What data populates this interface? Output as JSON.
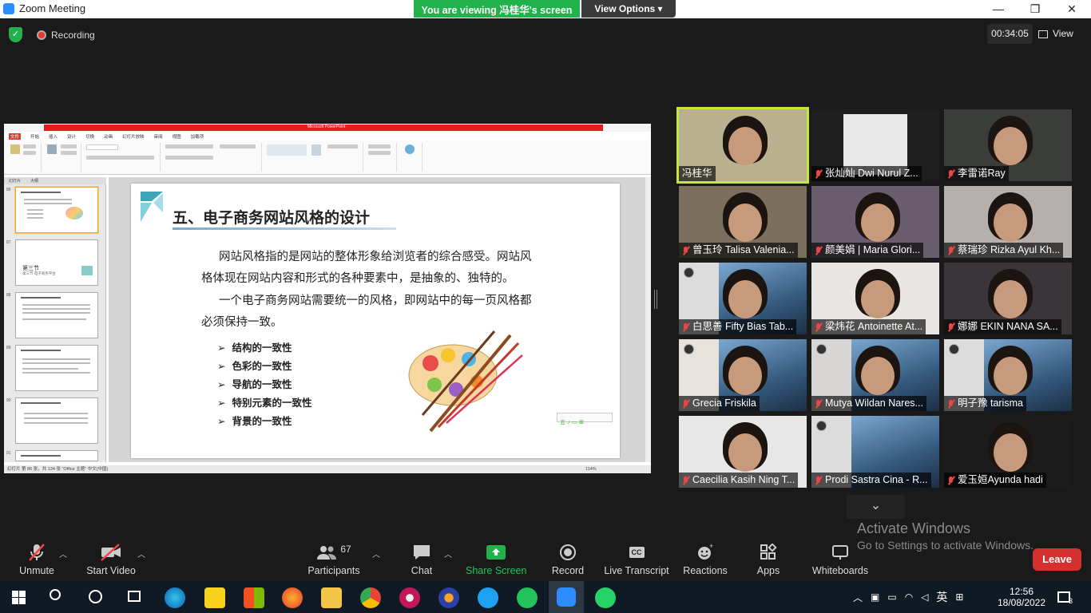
{
  "window": {
    "title": "Zoom Meeting",
    "minimize": "—",
    "restore": "❐",
    "close": "✕"
  },
  "banner": {
    "viewing": "You are viewing 冯桂华's screen",
    "view_options": "View Options ▾"
  },
  "status": {
    "recording": "Recording",
    "timer": "00:34:05",
    "view": "View"
  },
  "ppt": {
    "title": "Microsoft PowerPoint",
    "tabs": [
      "文件",
      "开始",
      "插入",
      "设计",
      "切换",
      "动画",
      "幻灯片放映",
      "审阅",
      "视图",
      "加载项"
    ],
    "left_tabs": [
      "幻灯片",
      "大纲"
    ],
    "slide_nums": [
      "86",
      "87",
      "88",
      "89",
      "90",
      "91"
    ],
    "thumb87_title": "第三节",
    "thumb87_sub": "第三节 电子商务平台",
    "status": "幻灯片 第 86 张，共 134 张    \"Office 主题\"    中文(中国)",
    "zoom": "114%"
  },
  "slide": {
    "title": "五、电子商务网站风格的设计",
    "para1_line1": "网站风格指的是网站的整体形象给浏览者的综合感受。网站风",
    "para1_line2": "格体现在网站内容和形式的各种要素中，是抽象的、独特的。",
    "para2_line1": "一个电子商务网站需要统一的风格，即网站中的每一页风格都",
    "para2_line2": "必须保持一致。",
    "bullets": [
      "结构的一致性",
      "色彩的一致性",
      "导航的一致性",
      "特别元素的一致性",
      "背景的一致性"
    ],
    "toolbar": "五·♪·▭·⊞"
  },
  "participants": [
    {
      "name": "冯桂华",
      "muted": false
    },
    {
      "name": "张灿灿 Dwi Nurul Z...",
      "muted": true
    },
    {
      "name": "李雷诺Ray",
      "muted": true
    },
    {
      "name": "曾玉玲 Talisa Valenia...",
      "muted": true
    },
    {
      "name": "颜美娟 | Maria Glori...",
      "muted": true
    },
    {
      "name": "蔡瑞珍 Rizka Ayul Kh...",
      "muted": true
    },
    {
      "name": "白思善 Fifty Bias Tab...",
      "muted": true
    },
    {
      "name": "梁炜花 Antoinette At...",
      "muted": true
    },
    {
      "name": "娜娜 EKIN NANA SA...",
      "muted": true
    },
    {
      "name": "Grecia Friskila",
      "muted": true
    },
    {
      "name": "Mutya Wildan Nares...",
      "muted": true
    },
    {
      "name": "明子豫 tarisma",
      "muted": true
    },
    {
      "name": "Caecilia Kasih Ning T...",
      "muted": true
    },
    {
      "name": "Prodi Sastra Cina - R...",
      "muted": true
    },
    {
      "name": "爱玉姮Ayunda hadi",
      "muted": true
    }
  ],
  "activate": {
    "line1": "Activate Windows",
    "line2": "Go to Settings to activate Windows."
  },
  "toolbar": {
    "unmute": "Unmute",
    "start_video": "Start Video",
    "participants": "Participants",
    "participant_count": "67",
    "chat": "Chat",
    "share_screen": "Share Screen",
    "record": "Record",
    "live_transcript": "Live Transcript",
    "reactions": "Reactions",
    "apps": "Apps",
    "whiteboards": "Whiteboards",
    "leave": "Leave",
    "cc": "CC"
  },
  "taskbar": {
    "ime": "英",
    "time": "12:56",
    "date": "18/08/2022",
    "notifications": "3"
  },
  "colors": {
    "zoom_blue": "#2d8cff",
    "share_green": "#22b24c",
    "leave_red": "#d43030",
    "active_speaker": "#c8e63a",
    "mute_red": "#e44444"
  }
}
